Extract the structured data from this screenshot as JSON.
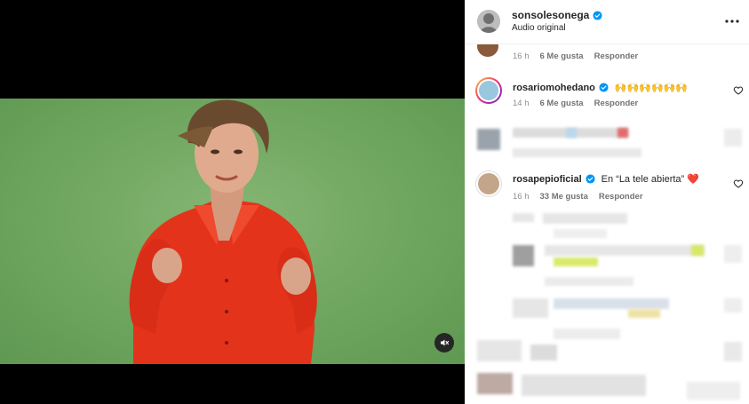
{
  "post": {
    "username": "sonsolesonega",
    "subtitle": "Audio original"
  },
  "comments": [
    {
      "time": "16 h",
      "likes": "6 Me gusta",
      "reply": "Responder"
    },
    {
      "username": "rosariomohedano",
      "text": "🙌🙌🙌🙌🙌🙌",
      "time": "14 h",
      "likes": "6 Me gusta",
      "reply": "Responder"
    },
    {
      "username": "rosapepioficial",
      "text": "En “La tele abierta” ❤️",
      "time": "16 h",
      "likes": "33 Me gusta",
      "reply": "Responder"
    }
  ],
  "colors": {
    "verified": "#0095f6",
    "heart": "#ed4956",
    "greenscreen": "#72a862",
    "shirt": "#e8341c"
  },
  "icons": [
    "mute-icon",
    "more-options-icon",
    "verified-badge-icon",
    "like-heart-icon"
  ]
}
